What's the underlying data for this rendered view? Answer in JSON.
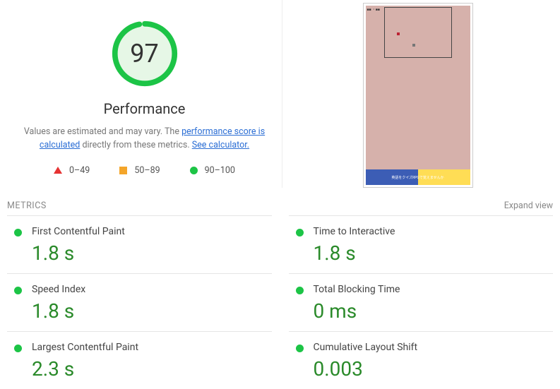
{
  "gauge": {
    "score": "97"
  },
  "header": {
    "title": "Performance",
    "note_prefix": "Values are estimated and may vary. The ",
    "note_link1": "performance score is calculated",
    "note_mid": " directly from these metrics. ",
    "note_link2": "See calculator."
  },
  "legend": {
    "red": "0–49",
    "orange": "50–89",
    "green": "90–100"
  },
  "metrics_section": {
    "title": "METRICS",
    "expand": "Expand view"
  },
  "metrics": [
    {
      "label": "First Contentful Paint",
      "value": "1.8 s"
    },
    {
      "label": "Time to Interactive",
      "value": "1.8 s"
    },
    {
      "label": "Speed Index",
      "value": "1.8 s"
    },
    {
      "label": "Total Blocking Time",
      "value": "0 ms"
    },
    {
      "label": "Largest Contentful Paint",
      "value": "2.3 s"
    },
    {
      "label": "Cumulative Layout Shift",
      "value": "0.003"
    }
  ],
  "thumbnail": {
    "banner_text": "英語をクイズRPGで覚えませんか"
  }
}
